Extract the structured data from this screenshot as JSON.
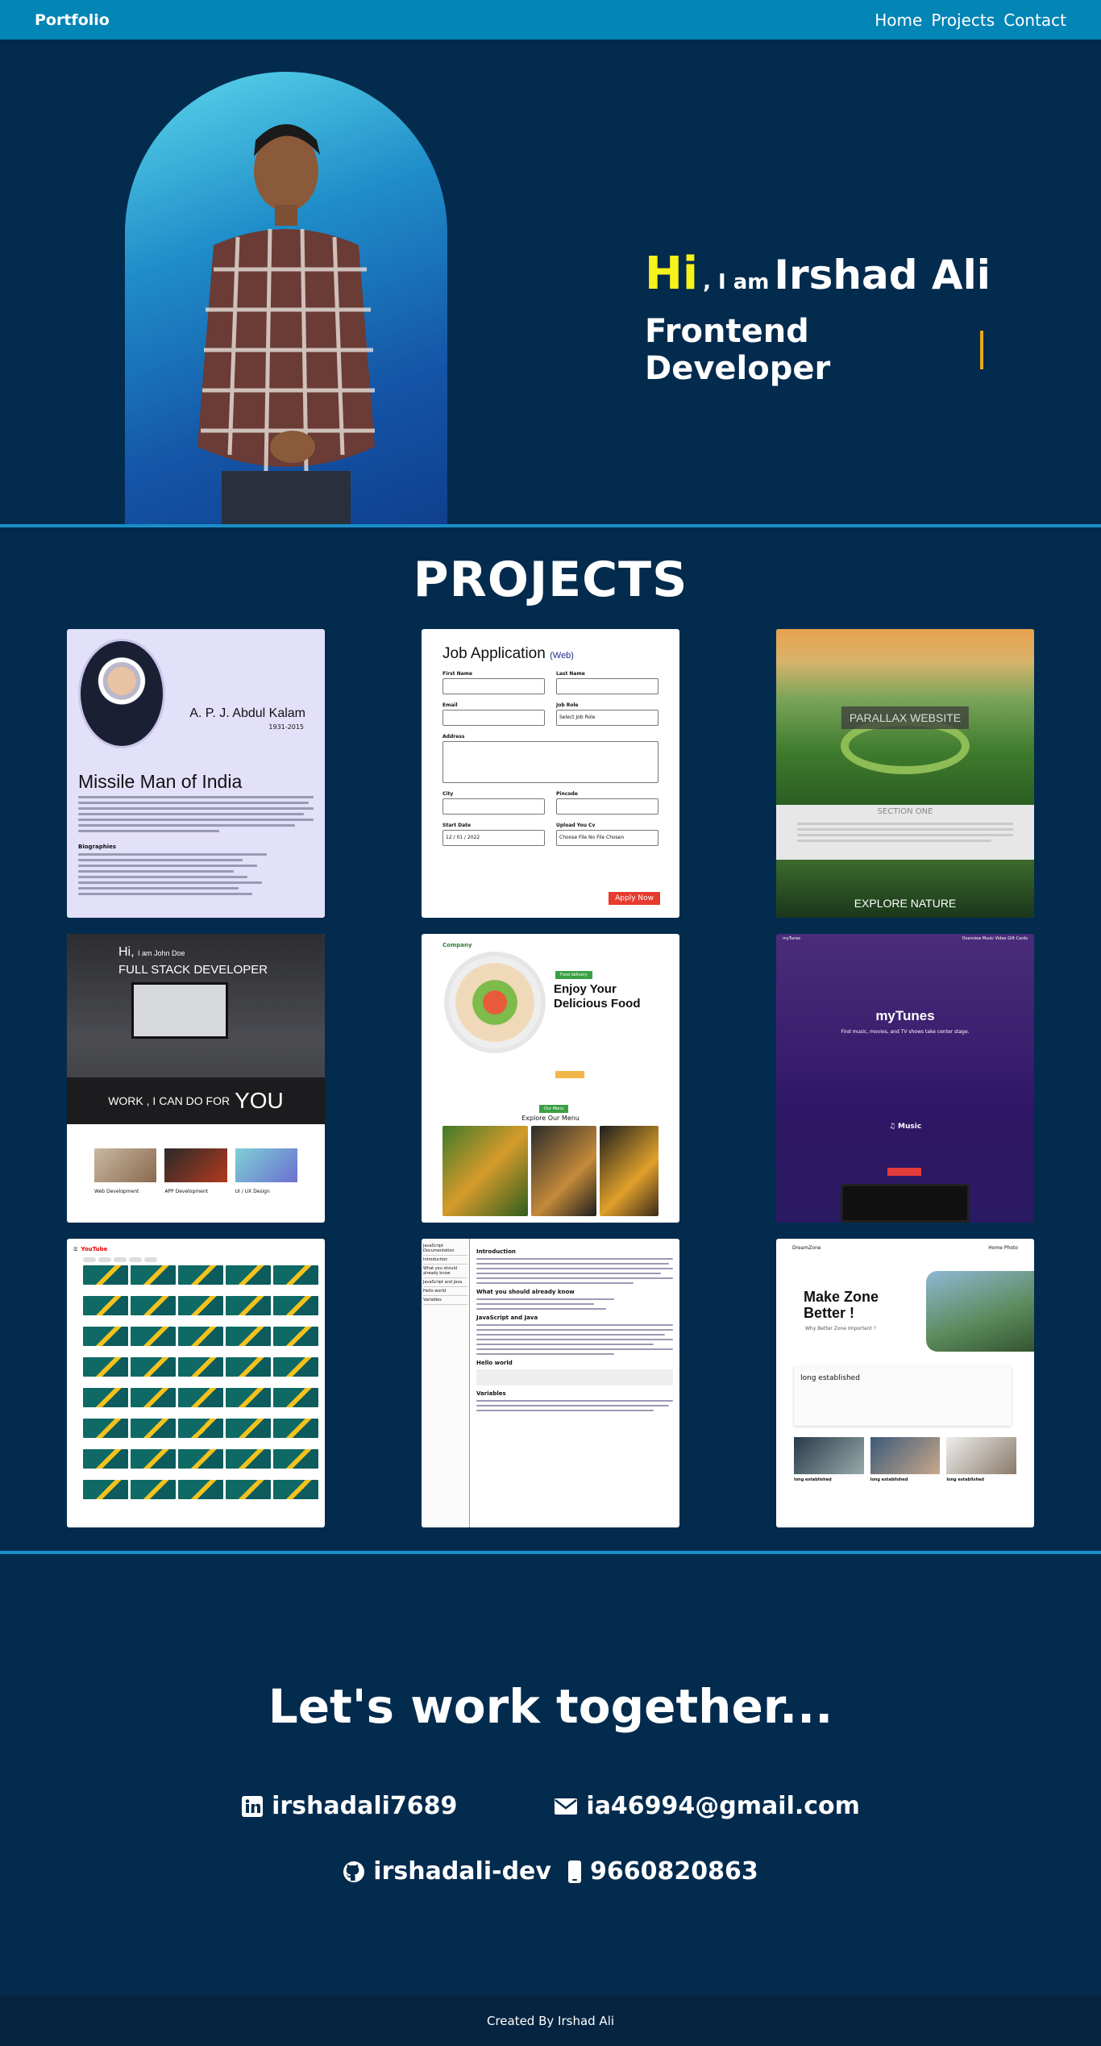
{
  "nav": {
    "brand": "Portfolio",
    "links": [
      "Home",
      "Projects",
      "Contact"
    ]
  },
  "hero": {
    "hi": "Hi",
    "iam": ", I am",
    "name": "Irshad Ali",
    "role": "Frontend Developer"
  },
  "projects": {
    "title": "PROJECTS",
    "kalam": {
      "name": "A. P. J. Abdul Kalam",
      "years": "1931-2015",
      "title": "Missile Man of India",
      "bio_heading": "Biographies"
    },
    "job": {
      "title": "Job Application",
      "tag": "(Web)",
      "first_name": "First Name",
      "last_name": "Last Name",
      "email": "Email",
      "job_role": "Job Role",
      "job_role_value": "Select Job Role",
      "address": "Address",
      "city": "City",
      "pincode": "Pincode",
      "start_date": "Start Date",
      "start_date_value": "12 / 01 / 2022",
      "upload": "Upload You Cv",
      "file_value": "Choose File  No File Chosen",
      "apply": "Apply Now"
    },
    "parallax": {
      "label": "PARALLAX WEBSITE",
      "section": "SECTION ONE",
      "explore": "EXPLORE NATURE"
    },
    "fullstack": {
      "hi": "Hi,",
      "iam": "I am John Doe",
      "role": "FULL STACK DEVELOPER",
      "work": "WORK , I CAN DO FOR",
      "you": "YOU",
      "tiles": [
        "Web Development",
        "APP Development",
        "UI / UX Design"
      ]
    },
    "food": {
      "logo": "Company",
      "badge": "Food delivery",
      "heading_1": "Enjoy Your",
      "heading_2": "Delicious Food",
      "menu_btn": "Our Menu",
      "menu": "Explore Our Menu"
    },
    "tunes": {
      "nav_brand": "myTunes",
      "nav_links": "Overview  Music  Video  Gift Cards",
      "title": "myTunes",
      "sub": "Find music, movies, and TV shows take center stage.",
      "music": "Music"
    },
    "youtube": {
      "logo": "YouTube"
    },
    "docs": {
      "side": [
        "JavaScript Documentation",
        "Introduction",
        "What you should already know",
        "JavaScript and Java",
        "Hello world",
        "Variables"
      ],
      "intro": "Introduction",
      "h_know": "What you should already know",
      "h_java": "JavaScript and Java",
      "h_hello": "Hello world",
      "h_vars": "Variables"
    },
    "dreamzone": {
      "brand": "DreamZone",
      "nav": "Home  Photo",
      "title_1": "Make Zone",
      "title_2": "Better !",
      "sub": "Why Better Zone Important ?",
      "established": "long established",
      "row": [
        "long established",
        "long established",
        "long established"
      ]
    }
  },
  "contact": {
    "title": "Let's work together...",
    "linkedin": "irshadali7689",
    "email": "ia46994@gmail.com",
    "github": "irshadali-dev",
    "phone": "9660820863"
  },
  "footer": {
    "text": "Created By Irshad Ali"
  },
  "colors": {
    "nav": "#0385b6",
    "bg": "#032b4e",
    "accent": "#f7f21a",
    "caret": "#e7a91b",
    "divider": "#1a8fc9"
  }
}
